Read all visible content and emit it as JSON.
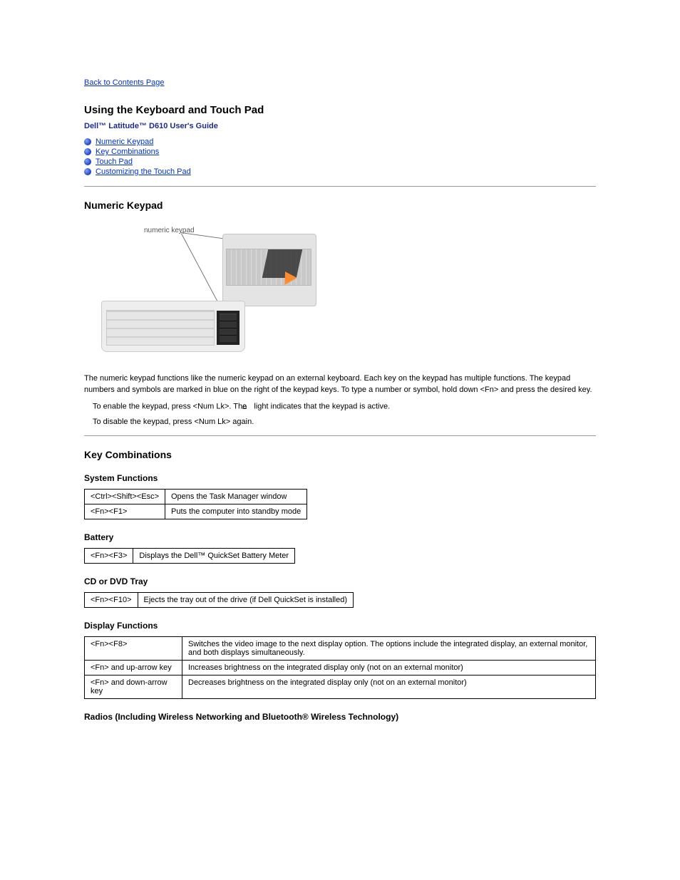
{
  "nav": {
    "back": "Back to Contents Page"
  },
  "title": "Using the Keyboard and Touch Pad",
  "guide": "Dell™ Latitude™ D610 User's Guide",
  "toc": [
    "Numeric Keypad",
    "Key Combinations",
    "Touch Pad",
    "Customizing the Touch Pad"
  ],
  "sections": {
    "numeric_keypad": {
      "heading": "Numeric Keypad",
      "figure_label": "numeric keypad",
      "p1": "The numeric keypad functions like the numeric keypad on an external keyboard. Each key on the keypad has multiple functions. The keypad numbers and symbols are marked in blue on the right of the keypad keys. To type a number or symbol, hold down <Fn> and press the desired key.",
      "li1_a": "To enable the keypad, press <Num Lk>. The ",
      "li1_b": " light indicates that the keypad is active.",
      "li2": "To disable the keypad, press <Num Lk> again.",
      "lock_glyph": "⌂"
    },
    "key_combinations": {
      "heading": "Key Combinations",
      "system": {
        "heading": "System Functions",
        "rows": [
          [
            "<Ctrl><Shift><Esc>",
            "Opens the Task Manager window"
          ],
          [
            "<Fn><F1>",
            "Puts the computer into standby mode"
          ]
        ]
      },
      "battery": {
        "heading": "Battery",
        "rows": [
          [
            "<Fn><F3>",
            "Displays the Dell™ QuickSet Battery Meter"
          ]
        ]
      },
      "tray": {
        "heading": "CD or DVD Tray",
        "rows": [
          [
            "<Fn><F10>",
            "Ejects the tray out of the drive (if Dell QuickSet is installed)"
          ]
        ]
      },
      "display": {
        "heading": "Display Functions",
        "rows": [
          [
            "<Fn><F8>",
            "Switches the video image to the next display option. The options include the integrated display, an external monitor, and both displays simultaneously."
          ],
          [
            "<Fn> and up-arrow key",
            "Increases brightness on the integrated display only (not on an external monitor)"
          ],
          [
            "<Fn> and down-arrow key",
            "Decreases brightness on the integrated display only (not on an external monitor)"
          ]
        ]
      },
      "radios": {
        "heading": "Radios (Including Wireless Networking and Bluetooth® Wireless Technology)"
      }
    }
  }
}
